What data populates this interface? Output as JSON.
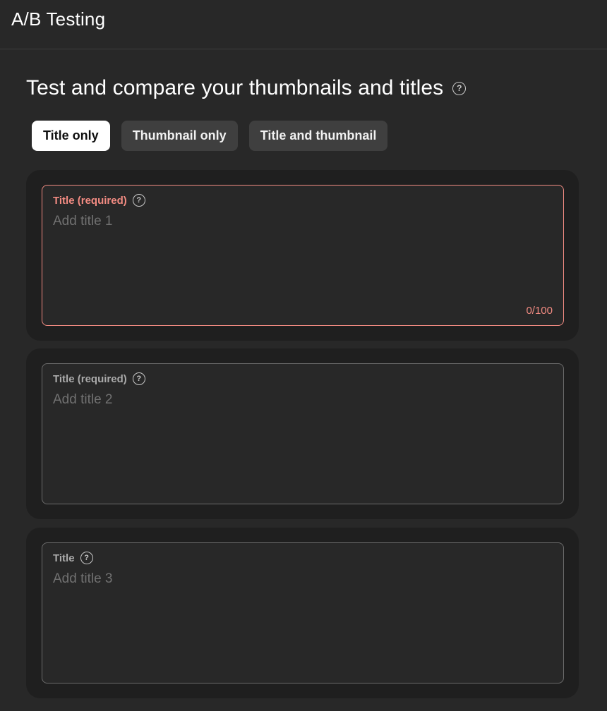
{
  "header": {
    "title": "A/B Testing"
  },
  "main": {
    "heading": "Test and compare your thumbnails and titles",
    "help_glyph": "?",
    "tabs": [
      {
        "label": "Title only",
        "active": true
      },
      {
        "label": "Thumbnail only",
        "active": false
      },
      {
        "label": "Title and thumbnail",
        "active": false
      }
    ],
    "fields": [
      {
        "label": "Title (required)",
        "placeholder": "Add title 1",
        "counter": "0/100",
        "state": "error"
      },
      {
        "label": "Title (required)",
        "placeholder": "Add title 2",
        "state": "default"
      },
      {
        "label": "Title",
        "placeholder": "Add title 3",
        "state": "default"
      }
    ]
  },
  "colors": {
    "background": "#282828",
    "card": "#1f1f1f",
    "error": "#f28b82",
    "active_tab": "#ffffff",
    "inactive_tab": "#3f3f3f"
  },
  "icons": {
    "help": "help-circle-icon"
  }
}
